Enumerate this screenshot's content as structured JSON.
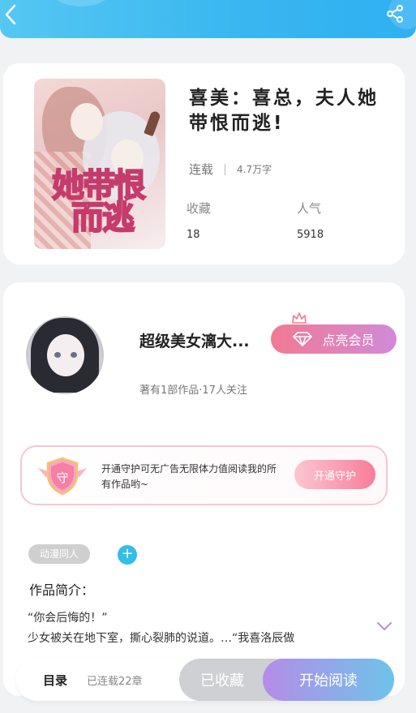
{
  "header": {
    "back_icon": "chevron-left-icon",
    "share_icon": "share-icon",
    "accent": "#38b6f0"
  },
  "book": {
    "title": "喜美：喜总，夫人她带恨而逃!",
    "cover_title_line1": "她带恨",
    "cover_title_line2": "而逃",
    "status": "连载",
    "word_count": "4.7万字",
    "stats": [
      {
        "label": "收藏",
        "value": "18"
      },
      {
        "label": "人气",
        "value": "5918"
      }
    ]
  },
  "author": {
    "name": "超级美女漓大...",
    "stats_text": "著有1部作品·17人关注",
    "vip_button": "点亮会员"
  },
  "guard": {
    "badge": "守",
    "text": "开通守护可无广告无限体力值阅读我的所有作品哟~",
    "button": "开通守护"
  },
  "tags": [
    "动漫同人"
  ],
  "add_tag": "+",
  "intro": {
    "label": "作品简介：",
    "line1": "“你会后悔的！”",
    "line2": "少女被关在地下室，撕心裂肺的说道。…“我喜洛辰做"
  },
  "bottom": {
    "toc": "目录",
    "serial": "已连载22章",
    "collected": "已收藏",
    "read": "开始阅读"
  }
}
